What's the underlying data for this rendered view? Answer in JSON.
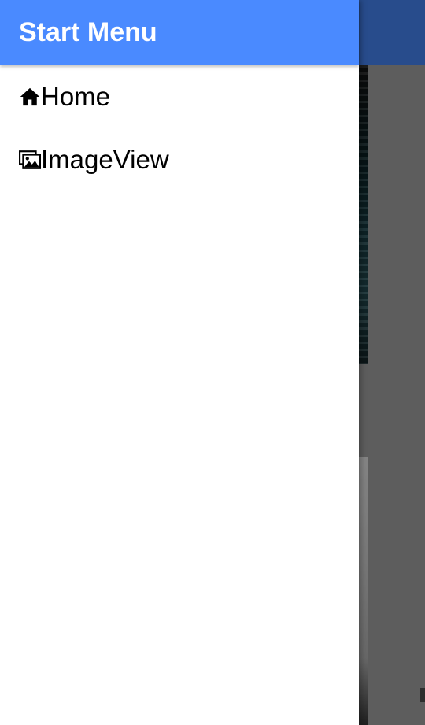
{
  "drawer": {
    "title": "Start Menu",
    "items": [
      {
        "label": "Home",
        "icon": "home-icon"
      },
      {
        "label": "ImageView",
        "icon": "images-icon"
      }
    ]
  },
  "colors": {
    "app_bar": "#4a8aff",
    "scrim": "rgba(0,0,0,0.45)",
    "drawer_background": "#ffffff",
    "text": "#000000"
  }
}
